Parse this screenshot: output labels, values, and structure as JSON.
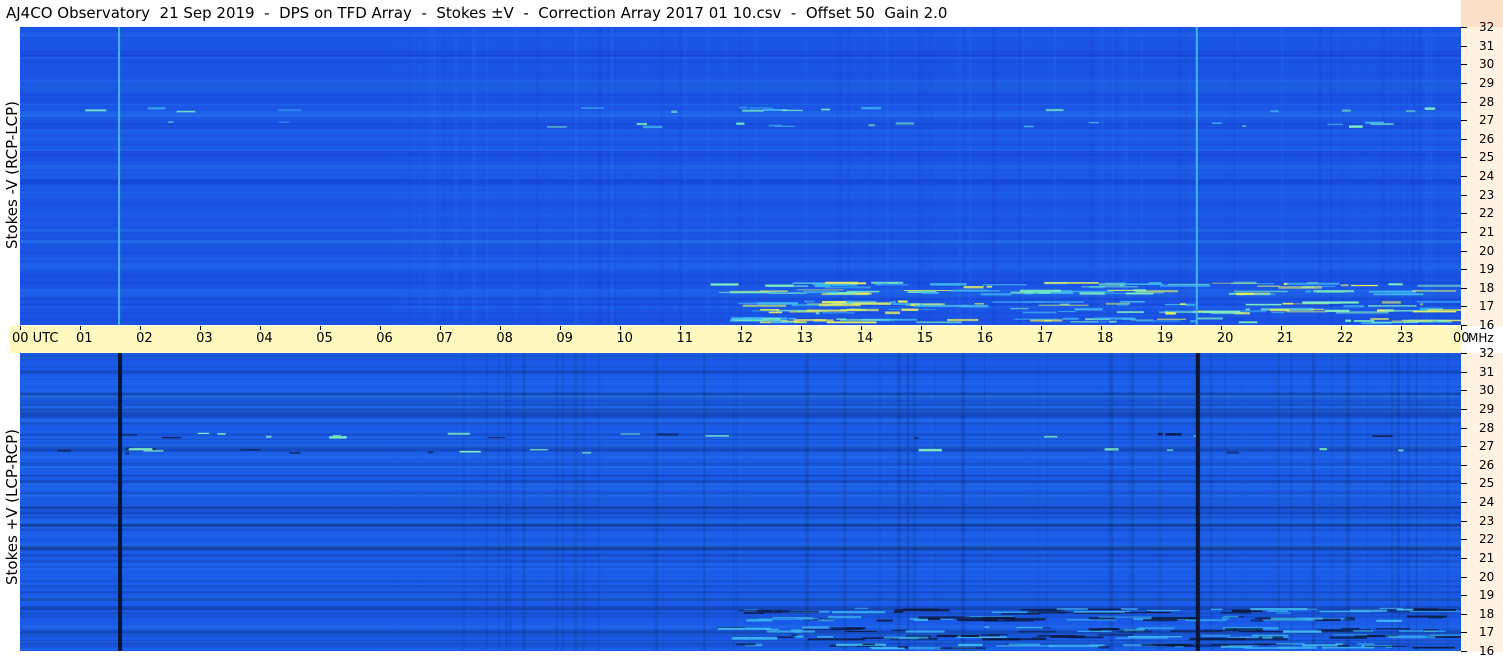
{
  "title": "AJ4CO Observatory  21 Sep 2019  -  DPS on TFD Array  -  Stokes ±V  -  Correction Array 2017 01 10.csv  -  Offset 50  Gain 2.0",
  "chart_data": [
    {
      "type": "heatmap",
      "panel": "top",
      "ylabel": "Stokes -V (RCP-LCP)",
      "x_unit": "UTC",
      "y_unit": "MHz",
      "xlim": [
        0,
        24
      ],
      "ylim": [
        16,
        32
      ],
      "x_ticks": [
        "00 UTC",
        "01",
        "02",
        "03",
        "04",
        "05",
        "06",
        "07",
        "08",
        "09",
        "10",
        "11",
        "12",
        "13",
        "14",
        "15",
        "16",
        "17",
        "18",
        "19",
        "20",
        "21",
        "22",
        "23",
        "00"
      ],
      "y_ticks": [
        16,
        17,
        18,
        19,
        20,
        21,
        22,
        23,
        24,
        25,
        26,
        27,
        28,
        29,
        30,
        31,
        32
      ],
      "colormap": [
        "#1439c8",
        "#1a56e8",
        "#2a86f0",
        "#3fb8f2",
        "#7ff2c0",
        "#e8f060",
        "#ff6a30"
      ],
      "vertical_lines_utc": [
        1.65,
        19.6
      ],
      "vertical_line_color": "#3fb8f2",
      "emission_bands_mhz": [
        16.3,
        16.8,
        17.2,
        17.8,
        18.2,
        26.8,
        27.6
      ]
    },
    {
      "type": "heatmap",
      "panel": "bottom",
      "ylabel": "Stokes +V (LCP-RCP)",
      "x_unit": "UTC",
      "y_unit": "MHz",
      "xlim": [
        0,
        24
      ],
      "ylim": [
        16,
        32
      ],
      "x_ticks": [
        "00 UTC",
        "01",
        "02",
        "03",
        "04",
        "05",
        "06",
        "07",
        "08",
        "09",
        "10",
        "11",
        "12",
        "13",
        "14",
        "15",
        "16",
        "17",
        "18",
        "19",
        "20",
        "21",
        "22",
        "23",
        "00"
      ],
      "y_ticks": [
        16,
        17,
        18,
        19,
        20,
        21,
        22,
        23,
        24,
        25,
        26,
        27,
        28,
        29,
        30,
        31,
        32
      ],
      "colormap": [
        "#0a1a40",
        "#1439c8",
        "#1a56e8",
        "#2a86f0",
        "#3fb8f2",
        "#7ff2c0"
      ],
      "vertical_lines_utc": [
        1.65,
        19.6
      ],
      "vertical_line_color": "#0b1430",
      "emission_bands_mhz": [
        16.3,
        16.8,
        17.2,
        17.8,
        18.2,
        26.8,
        27.6
      ]
    }
  ],
  "axis": {
    "mhz_label": "MHz"
  }
}
